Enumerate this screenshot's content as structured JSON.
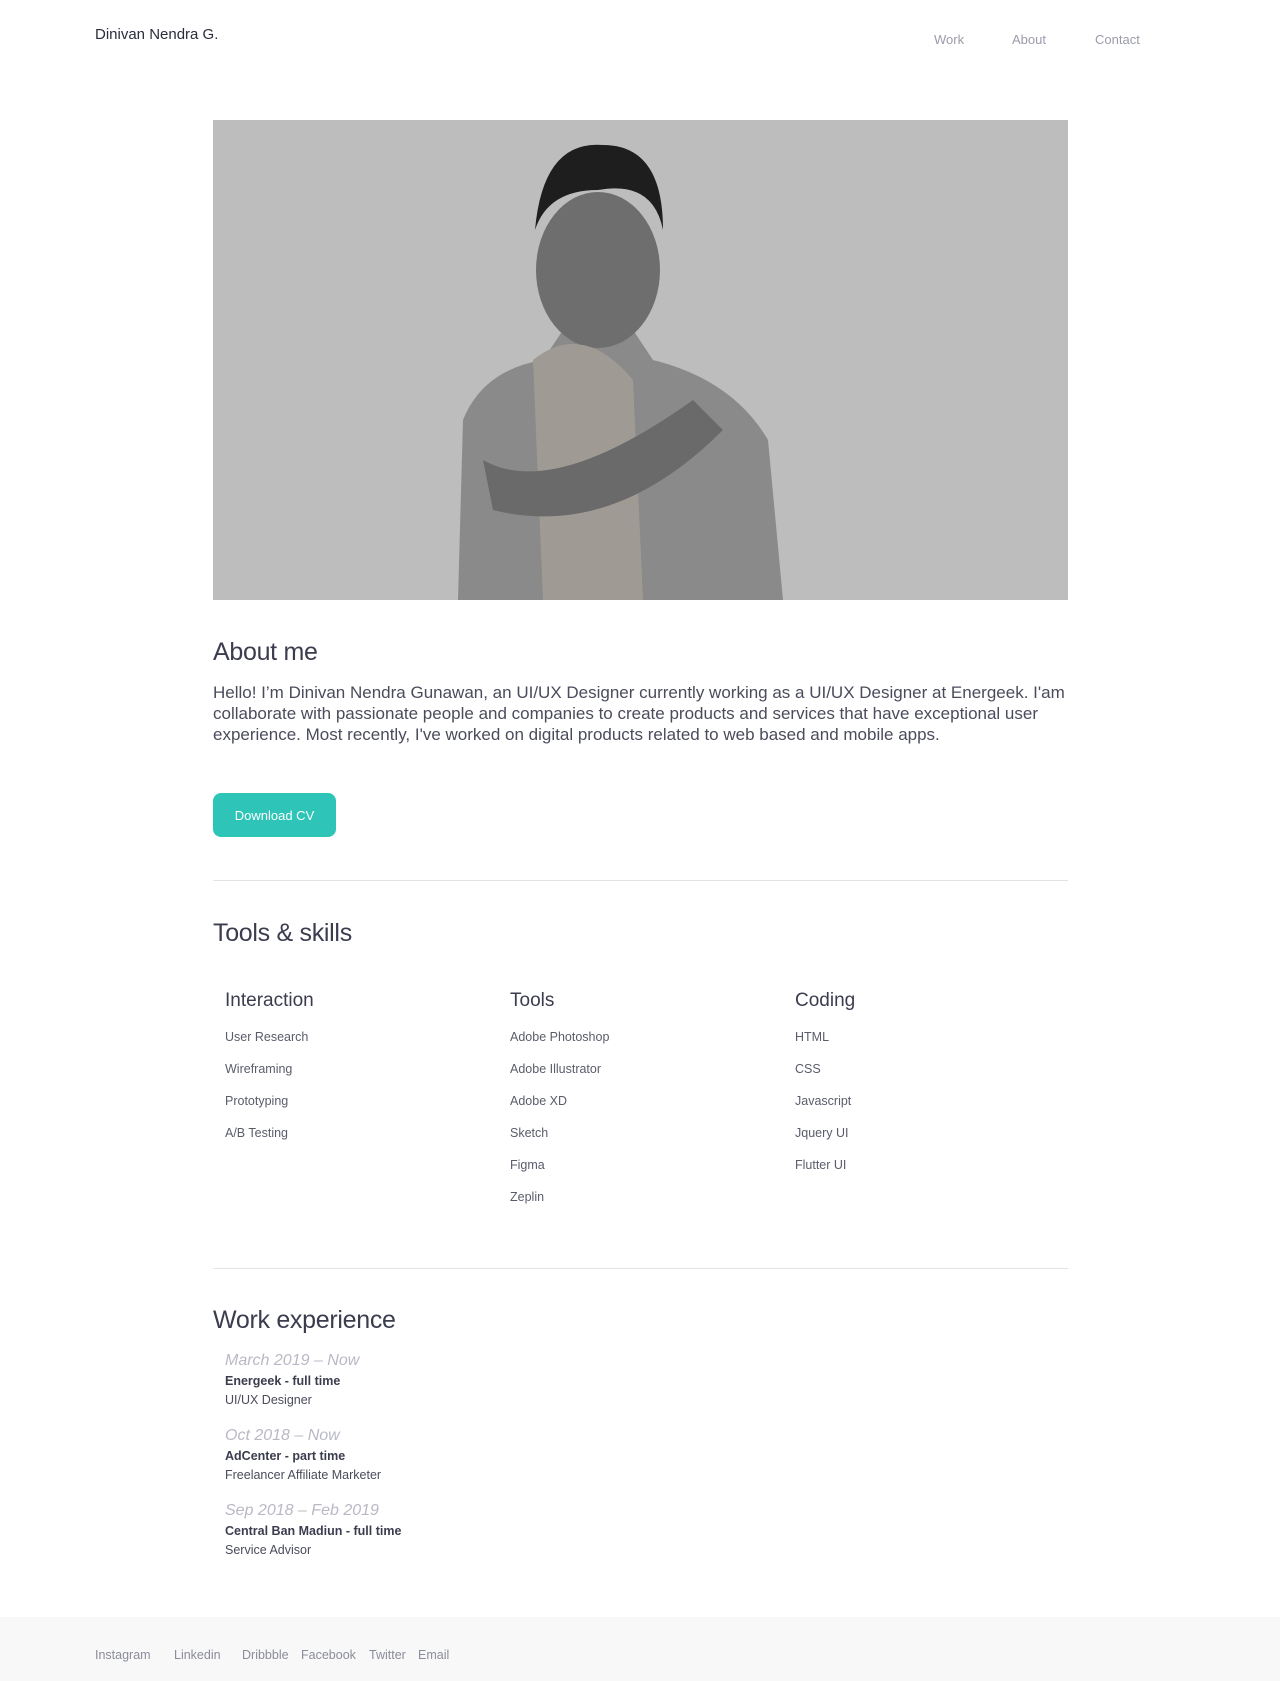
{
  "header": {
    "brand": "Dinivan Nendra G.",
    "nav": [
      "Work",
      "About",
      "Contact"
    ]
  },
  "about": {
    "title": "About me",
    "text": "Hello! I’m Dinivan Nendra Gunawan, an UI/UX Designer currently working as a UI/UX Designer at Energeek. I'am collaborate with passionate people and companies to create products and services that have exceptional user experience. Most recently, I've worked on digital products related to web based and mobile apps.",
    "button": "Download CV"
  },
  "skills": {
    "title": "Tools & skills",
    "columns": [
      {
        "title": "Interaction",
        "items": [
          "User Research",
          "Wireframing",
          "Prototyping",
          "A/B Testing"
        ]
      },
      {
        "title": "Tools",
        "items": [
          "Adobe Photoshop",
          "Adobe Illustrator",
          "Adobe XD",
          "Sketch",
          "Figma",
          "Zeplin"
        ]
      },
      {
        "title": "Coding",
        "items": [
          "HTML",
          "CSS",
          "Javascript",
          "Jquery UI",
          "Flutter UI"
        ]
      }
    ]
  },
  "work": {
    "title": "Work experience",
    "jobs": [
      {
        "date": "March 2019 – Now",
        "company": "Energeek - full time",
        "role": "UI/UX Designer"
      },
      {
        "date": "Oct 2018 – Now",
        "company": "AdCenter - part time",
        "role": "Freelancer Affiliate Marketer"
      },
      {
        "date": "Sep 2018 – Feb 2019",
        "company": "Central Ban Madiun - full time",
        "role": "Service Advisor"
      }
    ]
  },
  "footer": {
    "links": [
      "Instagram",
      "Linkedin",
      "Dribbble",
      "Facebook",
      "Twitter",
      "Email"
    ]
  }
}
